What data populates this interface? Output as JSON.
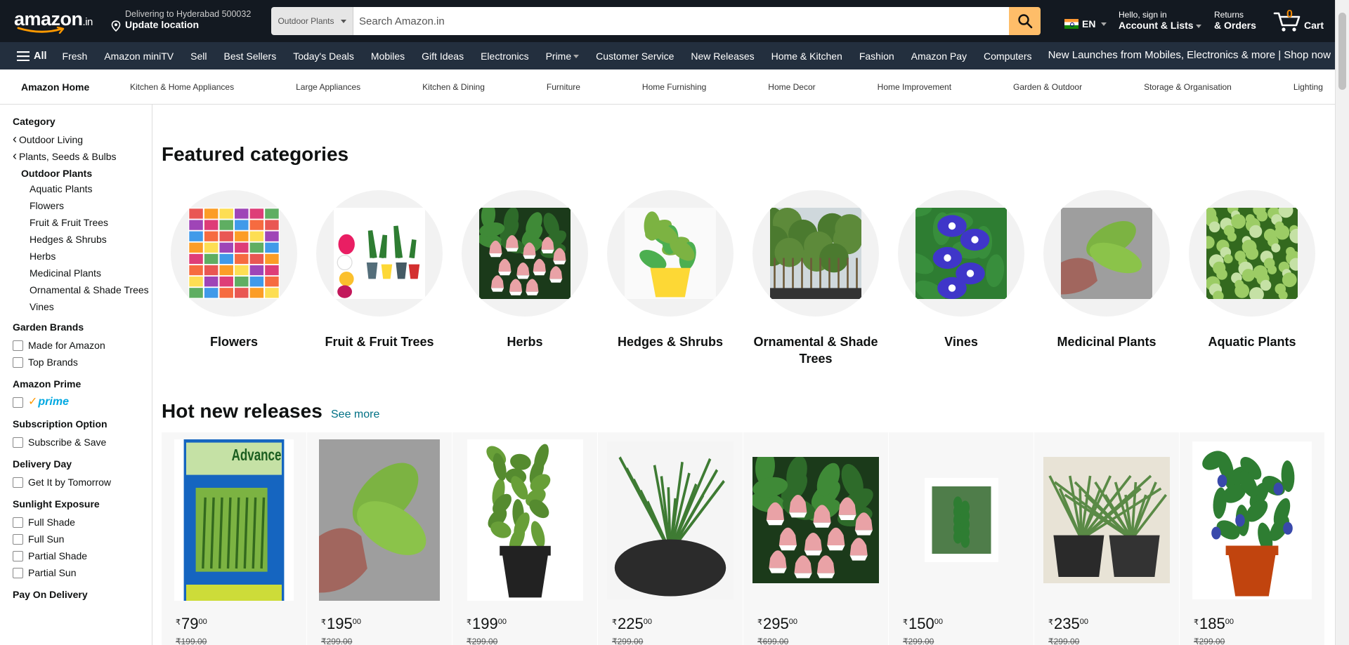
{
  "header": {
    "logo": {
      "text": "amazon",
      "suffix": ".in"
    },
    "deliver": {
      "line1": "Delivering to Hyderabad 500032",
      "line2": "Update location"
    },
    "search": {
      "category": "Outdoor Plants",
      "placeholder": "Search Amazon.in"
    },
    "language": "EN",
    "account": {
      "line1": "Hello, sign in",
      "line2": "Account & Lists"
    },
    "orders": {
      "line1": "Returns",
      "line2": "& Orders"
    },
    "cart": {
      "count": "0",
      "label": "Cart"
    }
  },
  "nav": {
    "all": "All",
    "items": [
      "Fresh",
      "Amazon miniTV",
      "Sell",
      "Best Sellers",
      "Today's Deals",
      "Mobiles",
      "Gift Ideas",
      "Electronics",
      "Prime",
      "Customer Service",
      "New Releases",
      "Home & Kitchen",
      "Fashion",
      "Amazon Pay",
      "Computers"
    ],
    "promo": "New Launches from Mobiles, Electronics & more | Shop now"
  },
  "subnav": {
    "title": "Amazon Home",
    "links": [
      "Kitchen & Home Appliances",
      "Large Appliances",
      "Kitchen & Dining",
      "Furniture",
      "Home Furnishing",
      "Home Decor",
      "Home Improvement",
      "Garden & Outdoor",
      "Storage & Organisation",
      "Lighting"
    ]
  },
  "sidebar": {
    "category_heading": "Category",
    "back_links": [
      "Outdoor Living",
      "Plants, Seeds & Bulbs"
    ],
    "current": "Outdoor Plants",
    "subcategories": [
      "Aquatic Plants",
      "Flowers",
      "Fruit & Fruit Trees",
      "Hedges & Shrubs",
      "Herbs",
      "Medicinal Plants",
      "Ornamental & Shade Trees",
      "Vines"
    ],
    "garden_brands": {
      "heading": "Garden Brands",
      "options": [
        "Made for Amazon",
        "Top Brands"
      ]
    },
    "amazon_prime": {
      "heading": "Amazon Prime",
      "label": "prime"
    },
    "subscription": {
      "heading": "Subscription Option",
      "options": [
        "Subscribe & Save"
      ]
    },
    "delivery_day": {
      "heading": "Delivery Day",
      "options": [
        "Get It by Tomorrow"
      ]
    },
    "sunlight": {
      "heading": "Sunlight Exposure",
      "options": [
        "Full Shade",
        "Full Sun",
        "Partial Shade",
        "Partial Sun"
      ]
    },
    "pay_on_delivery": {
      "heading": "Pay On Delivery"
    }
  },
  "featured": {
    "title": "Featured categories",
    "categories": [
      {
        "label": "Flowers",
        "image": "flower-seed-packets"
      },
      {
        "label": "Fruit & Fruit Trees",
        "image": "dragon-fruit-plants"
      },
      {
        "label": "Herbs",
        "image": "pink-bell-flowers"
      },
      {
        "label": "Hedges & Shrubs",
        "image": "potted-money-plant"
      },
      {
        "label": "Ornamental & Shade Trees",
        "image": "nursery-trees"
      },
      {
        "label": "Vines",
        "image": "blue-butterfly-pea"
      },
      {
        "label": "Medicinal Plants",
        "image": "leaf-in-hand"
      },
      {
        "label": "Aquatic Plants",
        "image": "duckweed"
      }
    ]
  },
  "hot_new": {
    "title": "Hot new releases",
    "see_more": "See more",
    "products": [
      {
        "symbol": "₹",
        "whole": "79",
        "fraction": "00",
        "mrp": "₹199.00",
        "image": "rosemary-seed-packet"
      },
      {
        "symbol": "₹",
        "whole": "195",
        "fraction": "00",
        "mrp": "₹299.00",
        "image": "leaf-in-hand"
      },
      {
        "symbol": "₹",
        "whole": "199",
        "fraction": "00",
        "mrp": "₹299.00",
        "image": "potted-tulsi"
      },
      {
        "symbol": "₹",
        "whole": "225",
        "fraction": "00",
        "mrp": "₹299.00",
        "image": "potted-rosemary"
      },
      {
        "symbol": "₹",
        "whole": "295",
        "fraction": "00",
        "mrp": "₹699.00",
        "image": "pink-bell-flowers"
      },
      {
        "symbol": "₹",
        "whole": "150",
        "fraction": "00",
        "mrp": "₹299.00",
        "image": "papaya-tree"
      },
      {
        "symbol": "₹",
        "whole": "235",
        "fraction": "00",
        "mrp": "₹299.00",
        "image": "two-potted-rosemary"
      },
      {
        "symbol": "₹",
        "whole": "185",
        "fraction": "00",
        "mrp": "₹299.00",
        "image": "potted-butterfly-pea"
      }
    ]
  },
  "colors": {
    "nav_dark": "#131921",
    "nav_secondary": "#232f3e",
    "search_button": "#febd69",
    "link": "#007185",
    "cart_count": "#f08804",
    "prime_blue": "#00a8e1"
  }
}
